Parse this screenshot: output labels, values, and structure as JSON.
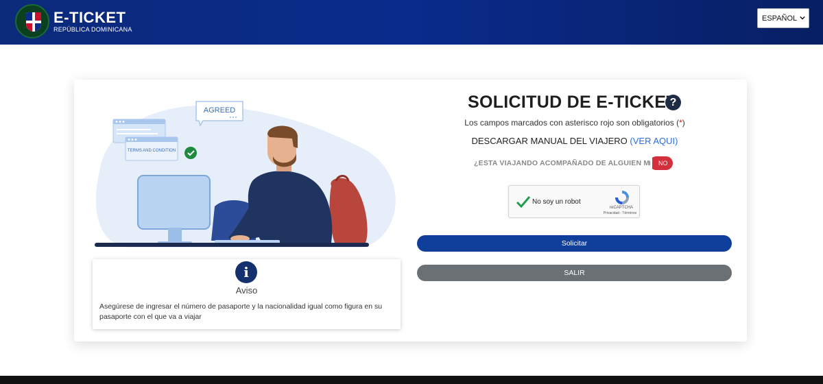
{
  "header": {
    "brand_title": "E-TICKET",
    "brand_subtitle": "REPÚBLICA DOMINICANA",
    "language_selected": "ESPAÑOL"
  },
  "illustration": {
    "bubble_text": "AGREED",
    "terms_text": "TERMS AND CONDITION"
  },
  "aviso": {
    "title": "Aviso",
    "text": "Asegúrese de ingresar el número de pasaporte y la nacionalidad igual como figura en su pasaporte con el que va a viajar"
  },
  "form": {
    "title": "SOLICITUD DE E-TICKET",
    "required_note_prefix": "Los campos marcados con asterisco rojo son obligatorios (",
    "required_star": "*",
    "required_note_suffix": ")",
    "manual_text": "DESCARGAR MANUAL DEL VIAJERO",
    "manual_link": "(VER AQUI)",
    "companion_question": "¿ESTA VIAJANDO ACOMPAÑADO DE ALGUIEN MAS?",
    "companion_toggle": "NO",
    "captcha_label": "No soy un robot",
    "captcha_brand": "reCAPTCHA",
    "captcha_links": "Privacidad - Términos",
    "submit_label": "Solicitar",
    "exit_label": "SALIR"
  },
  "colors": {
    "header": "#0b2a7a",
    "primary_button": "#0f3e9b",
    "secondary_button": "#6b7075",
    "toggle_off": "#d32f3c",
    "link": "#2a6edb"
  }
}
